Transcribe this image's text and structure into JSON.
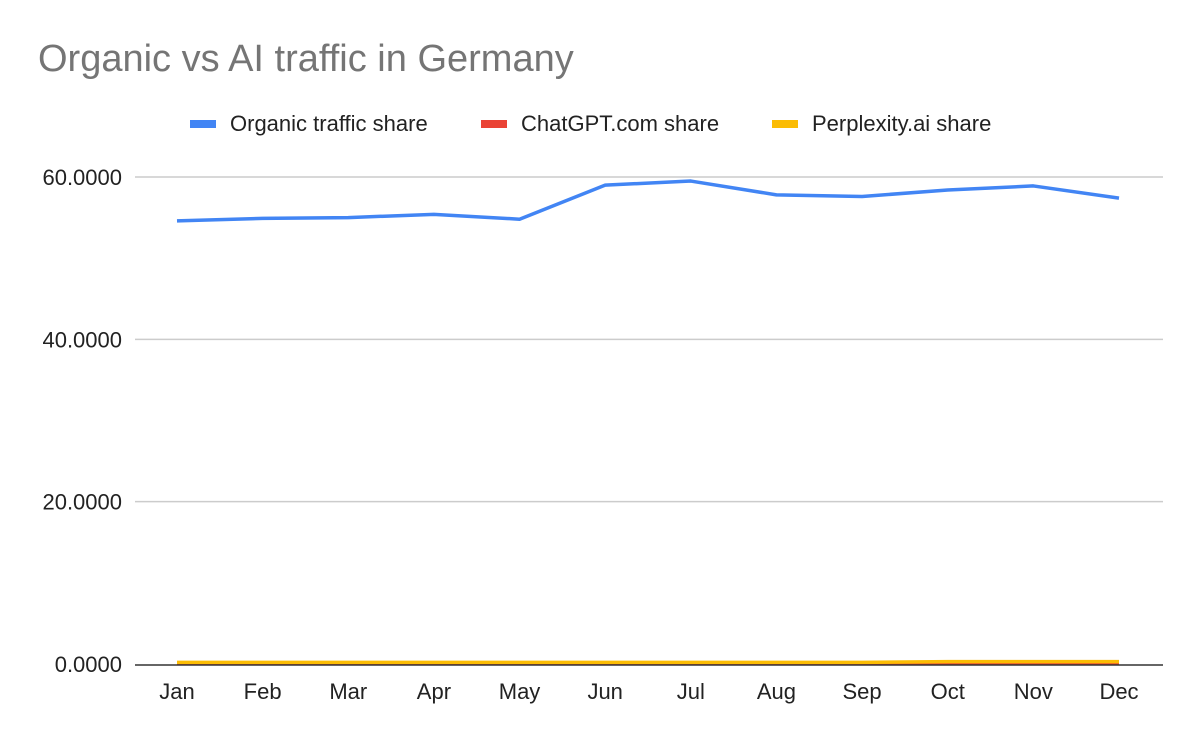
{
  "chart_data": {
    "type": "line",
    "title": "Organic vs AI traffic in Germany",
    "xlabel": "",
    "ylabel": "",
    "categories": [
      "Jan",
      "Feb",
      "Mar",
      "Apr",
      "May",
      "Jun",
      "Jul",
      "Aug",
      "Sep",
      "Oct",
      "Nov",
      "Dec"
    ],
    "ylim": [
      0,
      60
    ],
    "yticks": [
      0,
      20,
      40,
      60
    ],
    "ytick_labels": [
      "0.0000",
      "20.0000",
      "40.0000",
      "60.0000"
    ],
    "grid": true,
    "legend_position": "top",
    "series": [
      {
        "name": "Organic traffic share",
        "color": "#4285f4",
        "values": [
          54.6,
          54.9,
          55.0,
          55.4,
          54.8,
          59.0,
          59.5,
          57.8,
          57.6,
          58.4,
          58.9,
          57.4
        ]
      },
      {
        "name": "ChatGPT.com share",
        "color": "#ea4335",
        "values": [
          0.1,
          0.1,
          0.1,
          0.1,
          0.1,
          0.1,
          0.1,
          0.1,
          0.1,
          0.1,
          0.1,
          0.1
        ]
      },
      {
        "name": "Perplexity.ai share",
        "color": "#fbbc04",
        "values": [
          0.2,
          0.2,
          0.2,
          0.2,
          0.2,
          0.2,
          0.2,
          0.2,
          0.2,
          0.3,
          0.3,
          0.3
        ]
      }
    ]
  }
}
